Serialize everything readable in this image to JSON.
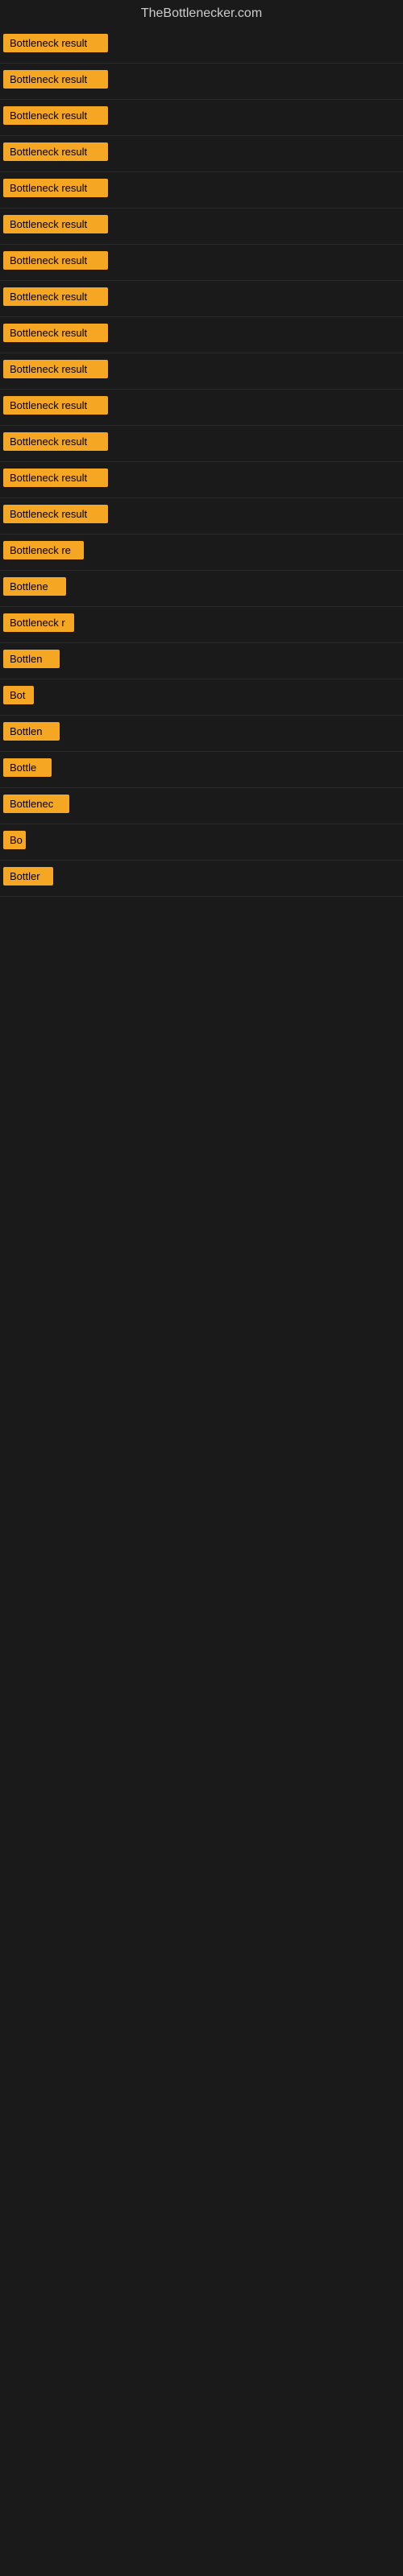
{
  "site": {
    "title": "TheBottlenecker.com"
  },
  "results": [
    {
      "id": 1,
      "label": "Bottleneck result",
      "width": 130
    },
    {
      "id": 2,
      "label": "Bottleneck result",
      "width": 130
    },
    {
      "id": 3,
      "label": "Bottleneck result",
      "width": 130
    },
    {
      "id": 4,
      "label": "Bottleneck result",
      "width": 130
    },
    {
      "id": 5,
      "label": "Bottleneck result",
      "width": 130
    },
    {
      "id": 6,
      "label": "Bottleneck result",
      "width": 130
    },
    {
      "id": 7,
      "label": "Bottleneck result",
      "width": 130
    },
    {
      "id": 8,
      "label": "Bottleneck result",
      "width": 130
    },
    {
      "id": 9,
      "label": "Bottleneck result",
      "width": 130
    },
    {
      "id": 10,
      "label": "Bottleneck result",
      "width": 130
    },
    {
      "id": 11,
      "label": "Bottleneck result",
      "width": 130
    },
    {
      "id": 12,
      "label": "Bottleneck result",
      "width": 130
    },
    {
      "id": 13,
      "label": "Bottleneck result",
      "width": 130
    },
    {
      "id": 14,
      "label": "Bottleneck result",
      "width": 130
    },
    {
      "id": 15,
      "label": "Bottleneck re",
      "width": 100
    },
    {
      "id": 16,
      "label": "Bottlene",
      "width": 78
    },
    {
      "id": 17,
      "label": "Bottleneck r",
      "width": 88
    },
    {
      "id": 18,
      "label": "Bottlen",
      "width": 70
    },
    {
      "id": 19,
      "label": "Bot",
      "width": 38
    },
    {
      "id": 20,
      "label": "Bottlen",
      "width": 70
    },
    {
      "id": 21,
      "label": "Bottle",
      "width": 60
    },
    {
      "id": 22,
      "label": "Bottlenec",
      "width": 82
    },
    {
      "id": 23,
      "label": "Bo",
      "width": 28
    },
    {
      "id": 24,
      "label": "Bottler",
      "width": 62
    }
  ],
  "colors": {
    "badge_bg": "#f5a623",
    "badge_text": "#000000",
    "bg": "#1a1a1a",
    "title_color": "#cccccc"
  }
}
